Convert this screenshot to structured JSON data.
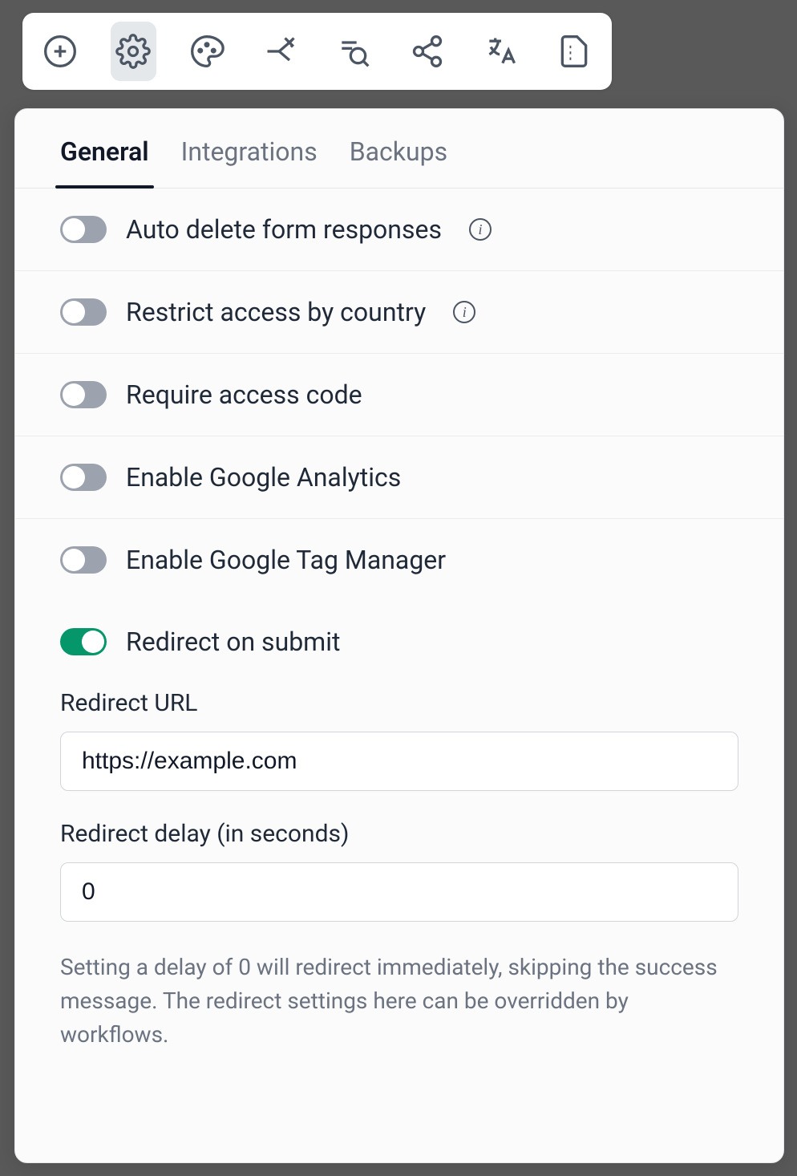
{
  "toolbar": {
    "items": [
      {
        "name": "add"
      },
      {
        "name": "settings",
        "active": true
      },
      {
        "name": "theme"
      },
      {
        "name": "branch"
      },
      {
        "name": "search"
      },
      {
        "name": "share"
      },
      {
        "name": "translate"
      },
      {
        "name": "file"
      }
    ]
  },
  "tabs": [
    {
      "label": "General",
      "active": true
    },
    {
      "label": "Integrations",
      "active": false
    },
    {
      "label": "Backups",
      "active": false
    }
  ],
  "settings": {
    "auto_delete": {
      "label": "Auto delete form responses",
      "on": false,
      "info": true
    },
    "restrict_country": {
      "label": "Restrict access by country",
      "on": false,
      "info": true
    },
    "access_code": {
      "label": "Require access code",
      "on": false,
      "info": false
    },
    "ga": {
      "label": "Enable Google Analytics",
      "on": false,
      "info": false
    },
    "gtm": {
      "label": "Enable Google Tag Manager",
      "on": false,
      "info": false
    },
    "redirect": {
      "label": "Redirect on submit",
      "on": true,
      "info": false
    }
  },
  "redirect_form": {
    "url_label": "Redirect URL",
    "url_value": "https://example.com",
    "delay_label": "Redirect delay (in seconds)",
    "delay_value": "0",
    "help": "Setting a delay of 0 will redirect immediately, skipping the success message. The redirect settings here can be overridden by workflows."
  }
}
